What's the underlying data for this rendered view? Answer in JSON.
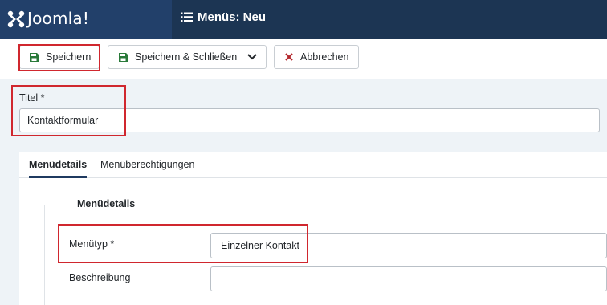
{
  "header": {
    "brand": "Joomla!",
    "page_title": "Menüs: Neu"
  },
  "toolbar": {
    "save_label": "Speichern",
    "save_close_label": "Speichern & Schließen",
    "cancel_label": "Abbrechen"
  },
  "form": {
    "title_label": "Titel *",
    "title_value": "Kontaktformular"
  },
  "tabs": [
    {
      "label": "Menüdetails",
      "active": true
    },
    {
      "label": "Menüberechtigungen",
      "active": false
    }
  ],
  "details": {
    "legend": "Menüdetails",
    "menutype_label": "Menütyp *",
    "menutype_value": "Einzelner Kontakt",
    "description_label": "Beschreibung",
    "description_value": ""
  },
  "colors": {
    "header_bg": "#1c3553",
    "logo_bg": "#22406a",
    "highlight": "#d0272e",
    "save_icon": "#2a7a3a",
    "cancel_icon": "#b3262c"
  },
  "icons": {
    "logo": "joomla-logo-icon",
    "menu": "list-icon",
    "save": "floppy-disk-icon",
    "dropdown": "chevron-down-icon",
    "cancel": "close-icon"
  }
}
